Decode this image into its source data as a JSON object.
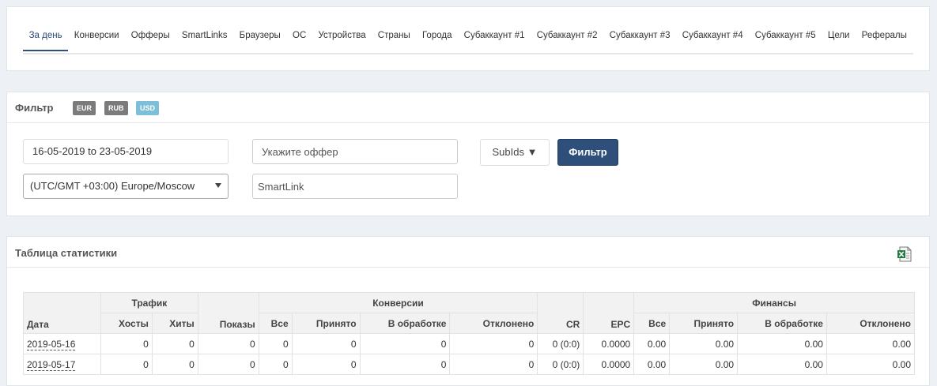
{
  "tabs": [
    "За день",
    "Конверсии",
    "Офферы",
    "SmartLinks",
    "Браузеры",
    "ОС",
    "Устройства",
    "Страны",
    "Города",
    "Субаккаунт #1",
    "Субаккаунт #2",
    "Субаккаунт #3",
    "Субаккаунт #4",
    "Субаккаунт #5",
    "Цели",
    "Рефералы"
  ],
  "active_tab": 0,
  "filter": {
    "title": "Фильтр",
    "currencies": [
      {
        "label": "EUR",
        "color": "#7b7b7b"
      },
      {
        "label": "RUB",
        "color": "#7b7b7b"
      },
      {
        "label": "USD",
        "color": "#7dbfd9"
      }
    ],
    "date_range": "16-05-2019 to 23-05-2019",
    "offer_placeholder": "Укажите оффер",
    "timezone": "(UTC/GMT +03:00) Europe/Moscow",
    "smartlink_placeholder": "SmartLink",
    "subids_label": "SubIds ▼",
    "filter_button": "Фильтр"
  },
  "stats": {
    "title": "Таблица статистики",
    "export_icon": "excel-export-icon",
    "groups": {
      "traffic": "Трафик",
      "conversions": "Конверсии",
      "finance": "Финансы"
    },
    "columns": {
      "date": "Дата",
      "hosts": "Хосты",
      "hits": "Хиты",
      "impressions": "Показы",
      "conv_all": "Все",
      "conv_accepted": "Принято",
      "conv_pending": "В обработке",
      "conv_rejected": "Отклонено",
      "cr": "CR",
      "epc": "EPC",
      "fin_all": "Все",
      "fin_accepted": "Принято",
      "fin_pending": "В обработке",
      "fin_rejected": "Отклонено"
    },
    "rows": [
      {
        "date": "2019-05-16",
        "hosts": "0",
        "hits": "0",
        "impressions": "0",
        "conv_all": "0",
        "conv_accepted": "0",
        "conv_pending": "0",
        "conv_rejected": "0",
        "cr": "0 (0:0)",
        "epc": "0.0000",
        "fin_all": "0.00",
        "fin_accepted": "0.00",
        "fin_pending": "0.00",
        "fin_rejected": "0.00"
      },
      {
        "date": "2019-05-17",
        "hosts": "0",
        "hits": "0",
        "impressions": "0",
        "conv_all": "0",
        "conv_accepted": "0",
        "conv_pending": "0",
        "conv_rejected": "0",
        "cr": "0 (0:0)",
        "epc": "0.0000",
        "fin_all": "0.00",
        "fin_accepted": "0.00",
        "fin_pending": "0.00",
        "fin_rejected": "0.00"
      }
    ]
  }
}
